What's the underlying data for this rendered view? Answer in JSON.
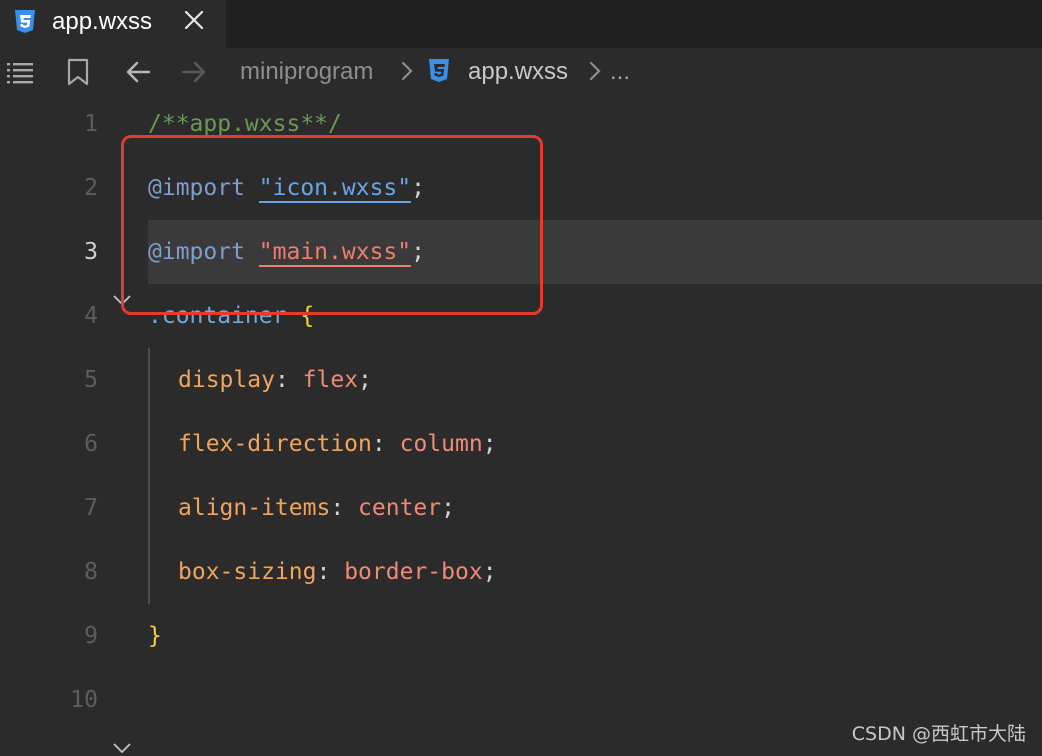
{
  "tab": {
    "title": "app.wxss",
    "icon": "css3-icon",
    "close_icon": "close-icon"
  },
  "toolbar": {
    "icons": [
      "outline-list-icon",
      "bookmark-icon",
      "arrow-left-icon",
      "arrow-right-icon"
    ],
    "breadcrumb": {
      "folder": "miniprogram",
      "file": "app.wxss",
      "more": "..."
    }
  },
  "editor": {
    "active_line": 3,
    "lines": [
      {
        "num": "1",
        "text": "/**app.wxss**/"
      },
      {
        "num": "2",
        "at": "@import",
        "str": "\"icon.wxss\"",
        "end": ";"
      },
      {
        "num": "3",
        "at": "@import",
        "str": "\"main.wxss\"",
        "end": ";"
      },
      {
        "num": "4",
        "selector": ".container",
        "brace": "{"
      },
      {
        "num": "5",
        "prop": "display",
        "colon": ":",
        "value": "flex",
        "end": ";"
      },
      {
        "num": "6",
        "prop": "flex-direction",
        "colon": ":",
        "value": "column",
        "end": ";"
      },
      {
        "num": "7",
        "prop": "align-items",
        "colon": ":",
        "value": "center",
        "end": ";"
      },
      {
        "num": "8",
        "prop": "box-sizing",
        "colon": ":",
        "value": "border-box",
        "end": ";"
      },
      {
        "num": "9",
        "brace": "}"
      },
      {
        "num": "10"
      }
    ]
  },
  "colors": {
    "highlight_box": "#e53b2c",
    "background": "#2b2b2b"
  },
  "watermark": "CSDN @西虹市大陆"
}
